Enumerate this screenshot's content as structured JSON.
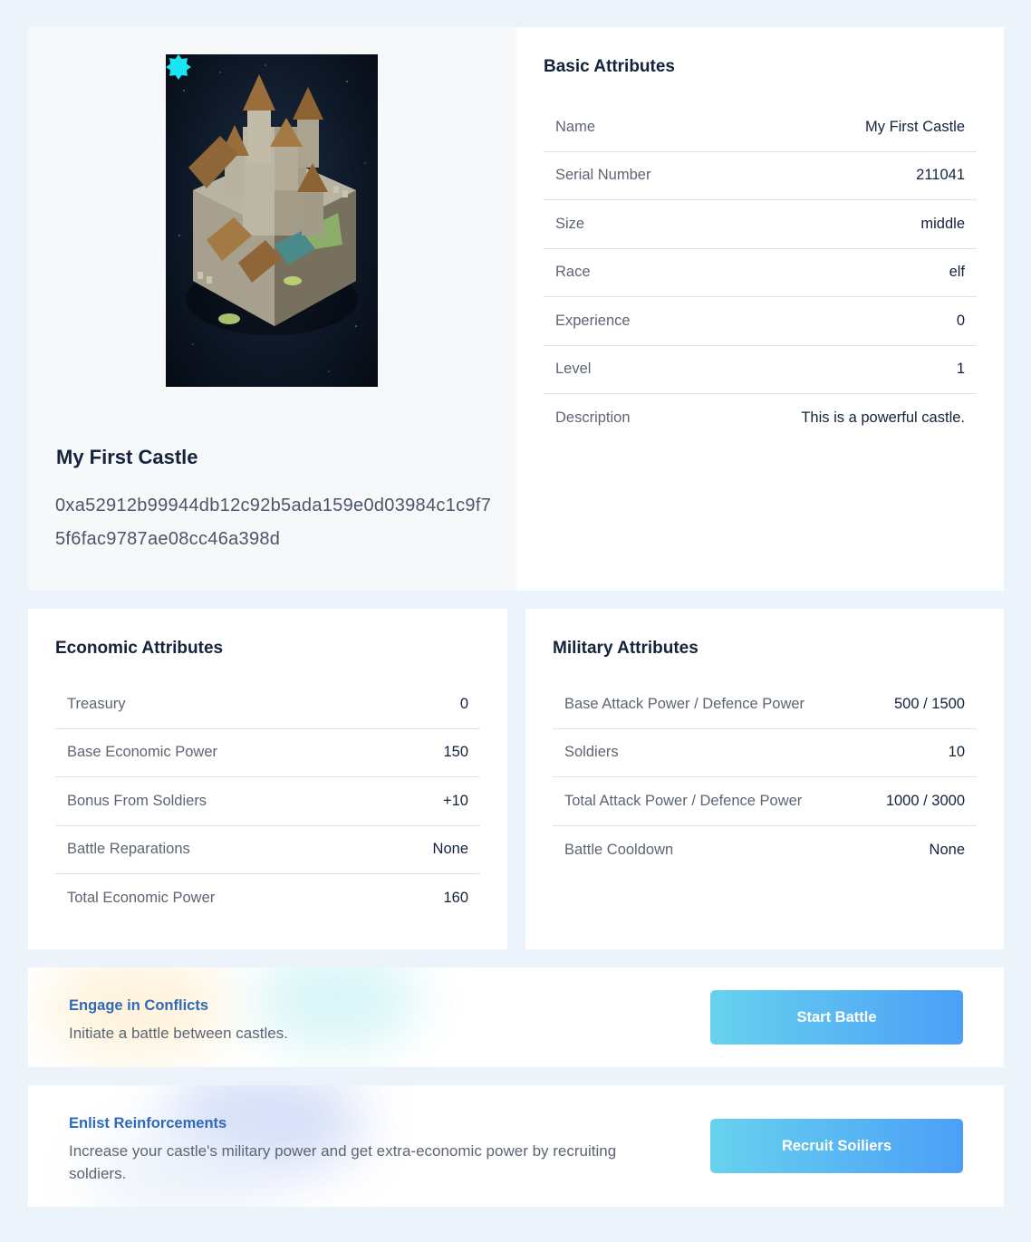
{
  "nft": {
    "name": "My First Castle",
    "address": "0xa52912b99944db12c92b5ada159e0d03984c1c9f75f6fac9787ae08cc46a398d",
    "badge_color": "#19e6f0"
  },
  "basic": {
    "title": "Basic Attributes",
    "rows": [
      {
        "label": "Name",
        "value": "My First Castle"
      },
      {
        "label": "Serial Number",
        "value": "211041"
      },
      {
        "label": "Size",
        "value": "middle"
      },
      {
        "label": "Race",
        "value": "elf"
      },
      {
        "label": "Experience",
        "value": "0"
      },
      {
        "label": "Level",
        "value": "1"
      },
      {
        "label": "Description",
        "value": "This is a powerful castle."
      }
    ]
  },
  "economic": {
    "title": "Economic Attributes",
    "rows": [
      {
        "label": "Treasury",
        "value": "0"
      },
      {
        "label": "Base Economic Power",
        "value": "150"
      },
      {
        "label": "Bonus From Soldiers",
        "value": "+10"
      },
      {
        "label": "Battle Reparations",
        "value": "None"
      },
      {
        "label": "Total Economic Power",
        "value": "160"
      }
    ]
  },
  "military": {
    "title": "Military Attributes",
    "rows": [
      {
        "label": "Base Attack Power / Defence Power",
        "value": "500 / 1500"
      },
      {
        "label": "Soldiers",
        "value": "10"
      },
      {
        "label": "Total Attack Power / Defence Power",
        "value": "1000 / 3000"
      },
      {
        "label": "Battle Cooldown",
        "value": "None"
      }
    ]
  },
  "actions": {
    "battle": {
      "title": "Engage in Conflicts",
      "description": "Initiate a battle between castles.",
      "button": "Start Battle"
    },
    "recruit": {
      "title": "Enlist Reinforcements",
      "description": "Increase your castle's military power and get extra-economic power by recruiting soldiers.",
      "button": "Recruit Soiliers"
    }
  },
  "colors": {
    "accent": "#2f6ab8",
    "button_start": "#67d2ee",
    "button_end": "#4c9ff7"
  }
}
